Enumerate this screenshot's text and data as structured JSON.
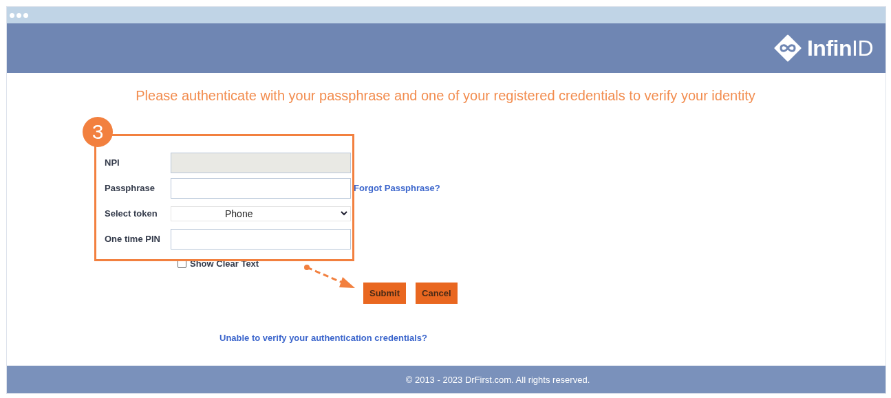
{
  "logo": {
    "text": "**Infin**ID"
  },
  "heading": "Please authenticate with your passphrase and one of your registered credentials to verify your identity",
  "callout": {
    "step": "3"
  },
  "fields": [
    {
      "label": "NPI",
      "kind": "text",
      "disabled": true
    },
    {
      "label": "Passphrase",
      "kind": "text",
      "link": "Forgot Passphrase?"
    },
    {
      "label": "Select token",
      "kind": "select",
      "value": "Phone"
    },
    {
      "label": "One time PIN",
      "kind": "text"
    }
  ],
  "show_clear_text": {
    "label": "Show Clear Text",
    "checked": false
  },
  "buttons": [
    "Submit",
    "Cancel"
  ],
  "help_link": "Unable to verify your authentication credentials?",
  "footer": "© 2013 - 2023 DrFirst.com. All rights reserved."
}
